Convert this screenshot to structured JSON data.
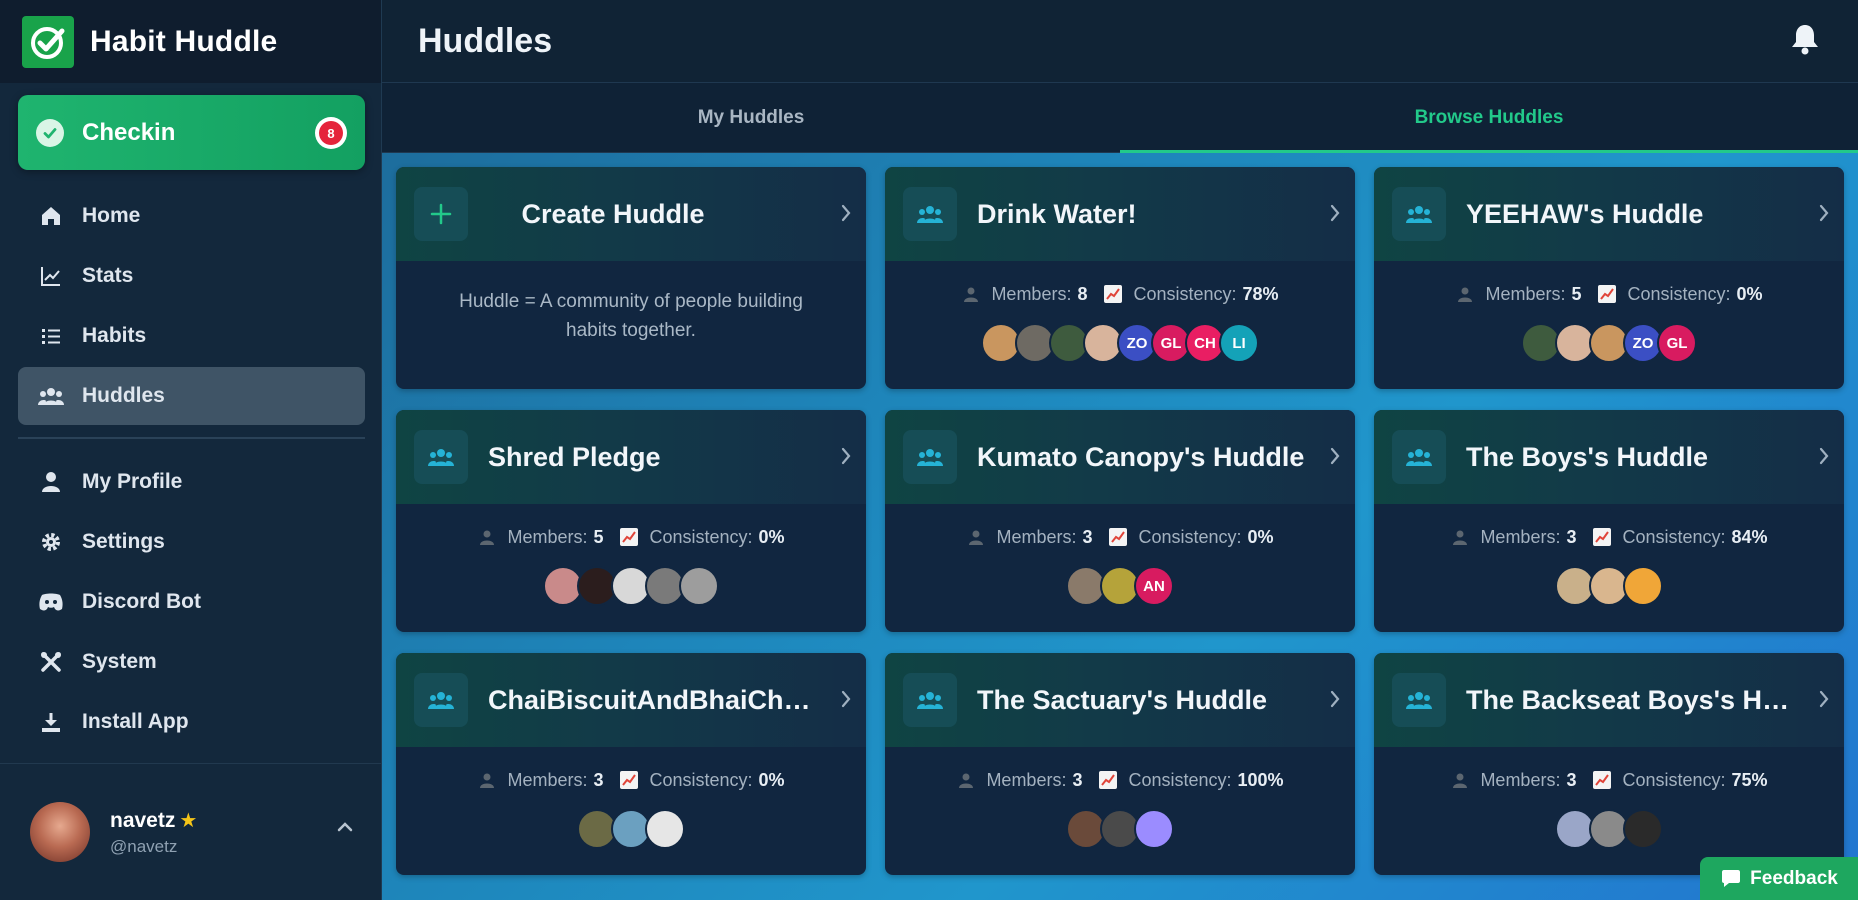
{
  "app": {
    "name": "Habit Huddle"
  },
  "checkin": {
    "label": "Checkin",
    "badge": "8"
  },
  "nav": {
    "primary": [
      {
        "label": "Home",
        "icon": "home-icon"
      },
      {
        "label": "Stats",
        "icon": "chart-icon"
      },
      {
        "label": "Habits",
        "icon": "list-icon"
      },
      {
        "label": "Huddles",
        "icon": "group-icon",
        "active": true
      }
    ],
    "secondary": [
      {
        "label": "My Profile",
        "icon": "user-icon"
      },
      {
        "label": "Settings",
        "icon": "gear-icon"
      },
      {
        "label": "Discord Bot",
        "icon": "discord-icon"
      },
      {
        "label": "System",
        "icon": "tools-icon"
      },
      {
        "label": "Install App",
        "icon": "download-icon"
      }
    ]
  },
  "user": {
    "name": "navetz",
    "handle": "@navetz"
  },
  "header": {
    "title": "Huddles"
  },
  "tabs": [
    {
      "label": "My Huddles",
      "active": false
    },
    {
      "label": "Browse Huddles",
      "active": true
    }
  ],
  "create_card": {
    "title": "Create Huddle",
    "description": "Huddle = A community of people building habits together."
  },
  "stat_labels": {
    "members": "Members:",
    "consistency": "Consistency:"
  },
  "huddles": [
    {
      "title": "Drink Water!",
      "members": "8",
      "consistency": "78%",
      "avatars": [
        {
          "initials": "",
          "color": "#c9965f"
        },
        {
          "initials": "",
          "color": "#6e6a63"
        },
        {
          "initials": "",
          "color": "#3e5b3e"
        },
        {
          "initials": "",
          "color": "#d8b49c"
        },
        {
          "initials": "ZO",
          "color": "#3b4fc4"
        },
        {
          "initials": "GL",
          "color": "#d81b60"
        },
        {
          "initials": "CH",
          "color": "#e91e63"
        },
        {
          "initials": "LI",
          "color": "#14a2b8"
        }
      ]
    },
    {
      "title": "YEEHAW's Huddle",
      "members": "5",
      "consistency": "0%",
      "avatars": [
        {
          "initials": "",
          "color": "#3e5b3e"
        },
        {
          "initials": "",
          "color": "#d8b49c"
        },
        {
          "initials": "",
          "color": "#c9965f"
        },
        {
          "initials": "ZO",
          "color": "#3b4fc4"
        },
        {
          "initials": "GL",
          "color": "#d81b60"
        }
      ]
    },
    {
      "title": "Shred Pledge",
      "members": "5",
      "consistency": "0%",
      "avatars": [
        {
          "initials": "",
          "color": "#c98a8a"
        },
        {
          "initials": "",
          "color": "#2b1d1d"
        },
        {
          "initials": "",
          "color": "#d8d8d8"
        },
        {
          "initials": "",
          "color": "#7a7a7a"
        },
        {
          "initials": "",
          "color": "#9d9d9d"
        }
      ]
    },
    {
      "title": "Kumato Canopy's Huddle",
      "members": "3",
      "consistency": "0%",
      "avatars": [
        {
          "initials": "",
          "color": "#8a7a6a"
        },
        {
          "initials": "",
          "color": "#b5a33a"
        },
        {
          "initials": "AN",
          "color": "#d81b60"
        }
      ]
    },
    {
      "title": "The Boys's Huddle",
      "members": "3",
      "consistency": "84%",
      "avatars": [
        {
          "initials": "",
          "color": "#c9b08a"
        },
        {
          "initials": "",
          "color": "#d9b68e"
        },
        {
          "initials": "",
          "color": "#f0a638"
        }
      ]
    },
    {
      "title": "ChaiBiscuitAndBhaiChara",
      "members": "3",
      "consistency": "0%",
      "avatars": [
        {
          "initials": "",
          "color": "#6b6a45"
        },
        {
          "initials": "",
          "color": "#6ba0c0"
        },
        {
          "initials": "",
          "color": "#e6e6e6"
        }
      ]
    },
    {
      "title": "The Sactuary's Huddle",
      "members": "3",
      "consistency": "100%",
      "avatars": [
        {
          "initials": "",
          "color": "#6a4a3a"
        },
        {
          "initials": "",
          "color": "#4a4a4a"
        },
        {
          "initials": "",
          "color": "#9b8cff"
        }
      ]
    },
    {
      "title": "The Backseat Boys's Huddle",
      "members": "3",
      "consistency": "75%",
      "avatars": [
        {
          "initials": "",
          "color": "#9aa6c8"
        },
        {
          "initials": "",
          "color": "#8a8a8a"
        },
        {
          "initials": "",
          "color": "#2a2a2a"
        }
      ]
    }
  ],
  "feedback": {
    "label": "Feedback"
  },
  "colors": {
    "accent": "#22c98a",
    "checkin": "#1fb46f",
    "badge": "#e5243b"
  }
}
